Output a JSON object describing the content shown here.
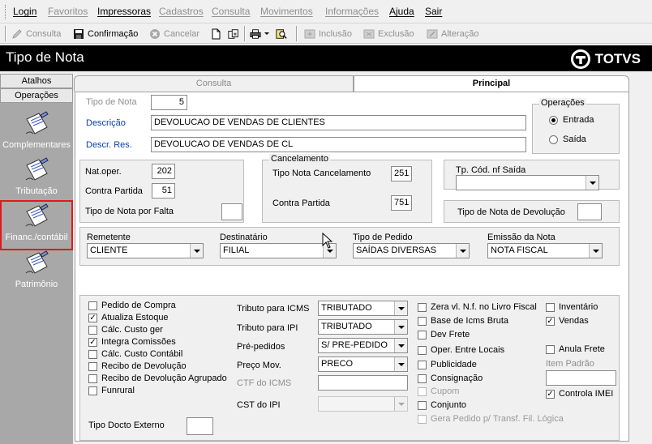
{
  "menu": [
    {
      "label": "Login",
      "enabled": true
    },
    {
      "label": "Favoritos",
      "enabled": false
    },
    {
      "label": "Impressoras",
      "enabled": true
    },
    {
      "label": "Cadastros",
      "enabled": false
    },
    {
      "label": "Consulta",
      "enabled": false
    },
    {
      "label": "Movimentos",
      "enabled": false
    },
    {
      "label": "Informações",
      "enabled": false
    },
    {
      "label": "Ajuda",
      "enabled": true
    },
    {
      "label": "Sair",
      "enabled": true
    }
  ],
  "toolbar": {
    "consulta": "Consulta",
    "confirmacao": "Confirmação",
    "cancelar": "Cancelar",
    "inclusao": "Inclusão",
    "exclusao": "Exclusão",
    "alteracao": "Alteração"
  },
  "window": {
    "title": "Tipo de Nota",
    "brand": "TOTVS"
  },
  "sidebar": {
    "tabs": [
      "Atalhos",
      "Operações"
    ],
    "items": [
      {
        "label": "Complementares",
        "icon": "document-pen-icon"
      },
      {
        "label": "Tributação",
        "icon": "document-pen-icon"
      },
      {
        "label": "Financ./contábil",
        "icon": "document-pen-icon",
        "selected": true
      },
      {
        "label": "Patrimônio",
        "icon": "document-pen-icon"
      }
    ]
  },
  "tabs": {
    "consulta": "Consulta",
    "principal": "Principal"
  },
  "form": {
    "tipo_nota_label": "Tipo de Nota",
    "tipo_nota_value": "5",
    "descricao_label": "Descrição",
    "descricao_value": "DEVOLUCAO DE VENDAS DE CLIENTES",
    "descr_res_label": "Descr. Res.",
    "descr_res_value": "DEVOLUCAO DE VENDAS DE CL",
    "operacoes_title": "Operações",
    "operacoes_options": [
      "Entrada",
      "Saída"
    ],
    "operacoes_selected": "Entrada",
    "nat_oper_label": "Nat.oper.",
    "nat_oper_value": "202",
    "contra_partida_label": "Contra Partida",
    "contra_partida_value": "51",
    "tipo_nota_falta_label": "Tipo de Nota por Falta",
    "tipo_nota_falta_value": "",
    "cancelamento_title": "Cancelamento",
    "tipo_nota_cancel_label": "Tipo Nota Cancelamento",
    "tipo_nota_cancel_value": "251",
    "cancel_contra_partida_label": "Contra Partida",
    "cancel_contra_partida_value": "751",
    "tp_cod_nf_saida_label": "Tp. Cód. nf Saída",
    "tp_cod_nf_saida_value": "",
    "tipo_nota_devolucao_label": "Tipo de Nota de Devolução",
    "tipo_nota_devolucao_value": "",
    "remetente_label": "Remetente",
    "remetente_value": "CLIENTE",
    "destinatario_label": "Destinatário",
    "destinatario_value": "FILIAL",
    "tipo_pedido_label": "Tipo de Pedido",
    "tipo_pedido_value": "SAÍDAS DIVERSAS",
    "emissao_nota_label": "Emissão da Nota",
    "emissao_nota_value": "NOTA FISCAL",
    "tributo_icms_label": "Tributo para ICMS",
    "tributo_icms_value": "TRIBUTADO",
    "tributo_ipi_label": "Tributo para IPI",
    "tributo_ipi_value": "TRIBUTADO",
    "pre_pedidos_label": "Pré-pedidos",
    "pre_pedidos_value": "S/ PRE-PEDIDO",
    "preco_mov_label": "Preço Mov.",
    "preco_mov_value": "PRECO",
    "ctf_icms_label": "CTF do ICMS",
    "ctf_icms_value": "",
    "cst_ipi_label": "CST do IPI",
    "cst_ipi_value": "",
    "tipo_docto_externo_label": "Tipo Docto Externo",
    "tipo_docto_externo_value": "",
    "item_padrao_label": "Item Padrão",
    "item_padrao_value": ""
  },
  "checks_left": [
    {
      "label": "Pedido de Compra",
      "checked": false
    },
    {
      "label": "Atualiza Estoque",
      "checked": true
    },
    {
      "label": "Cálc. Custo ger",
      "checked": false
    },
    {
      "label": "Integra Comissões",
      "checked": true
    },
    {
      "label": "Cálc. Custo Contábil",
      "checked": false
    },
    {
      "label": "Recibo de Devolução",
      "checked": false
    },
    {
      "label": "Recibo de Devolução Agrupado",
      "checked": false
    },
    {
      "label": "Funrural",
      "checked": false
    }
  ],
  "checks_mid": [
    {
      "label": "Zera vl. N.f. no Livro Fiscal",
      "checked": false,
      "enabled": true
    },
    {
      "label": "Base de Icms Bruta",
      "checked": false,
      "enabled": true
    },
    {
      "label": "Dev Frete",
      "checked": false,
      "enabled": true
    },
    {
      "label": "Oper. Entre Locais",
      "checked": false,
      "enabled": true
    },
    {
      "label": "Publicidade",
      "checked": false,
      "enabled": true
    },
    {
      "label": "Consignação",
      "checked": false,
      "enabled": true
    },
    {
      "label": "Cupom",
      "checked": false,
      "enabled": false
    },
    {
      "label": "Conjunto",
      "checked": false,
      "enabled": true
    },
    {
      "label": "Gera Pedido p/ Transf. Fil. Lógica",
      "checked": false,
      "enabled": false
    }
  ],
  "checks_right": [
    {
      "label": "Inventário",
      "checked": false
    },
    {
      "label": "Vendas",
      "checked": true
    },
    {
      "label": "Anula Frete",
      "checked": false
    },
    {
      "label": "Controla IMEI",
      "checked": true
    }
  ]
}
